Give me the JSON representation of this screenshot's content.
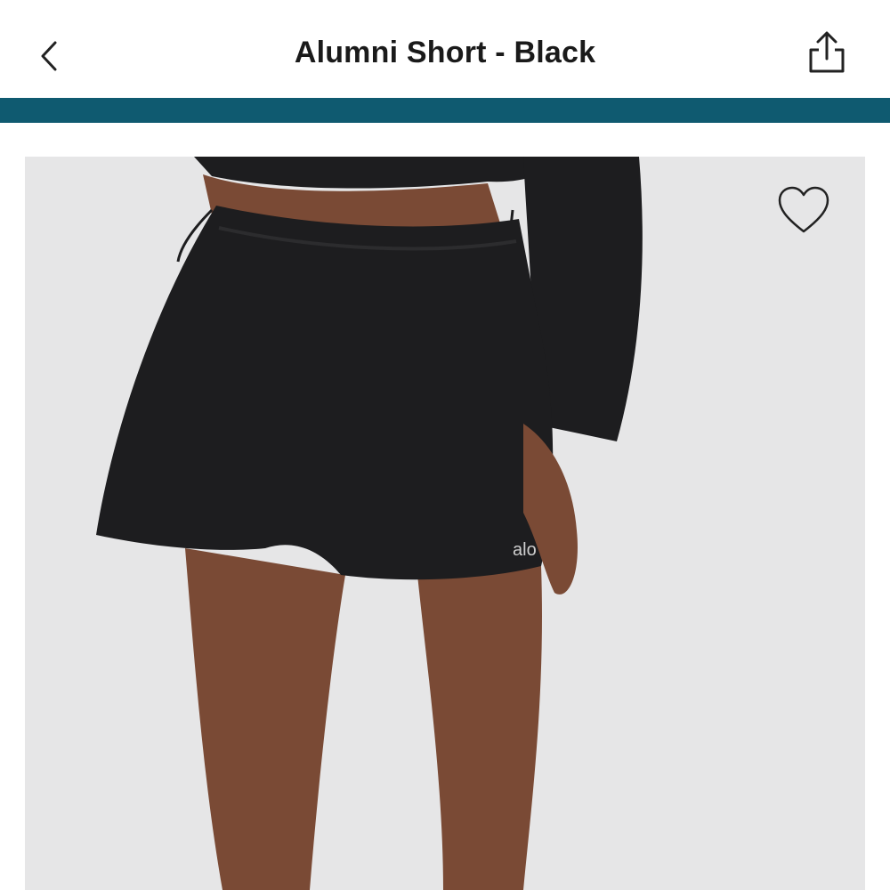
{
  "header": {
    "title": "Alumni Short - Black",
    "back_icon": "chevron-left-icon",
    "share_icon": "share-icon"
  },
  "accent_bar": {
    "color": "#0f5a70"
  },
  "product_image": {
    "background_color": "#e6e6e7",
    "garment_color": "#1d1d1f",
    "skin_color": "#7a4a35",
    "logo_text": "alo",
    "favorite_icon": "heart-outline-icon"
  }
}
